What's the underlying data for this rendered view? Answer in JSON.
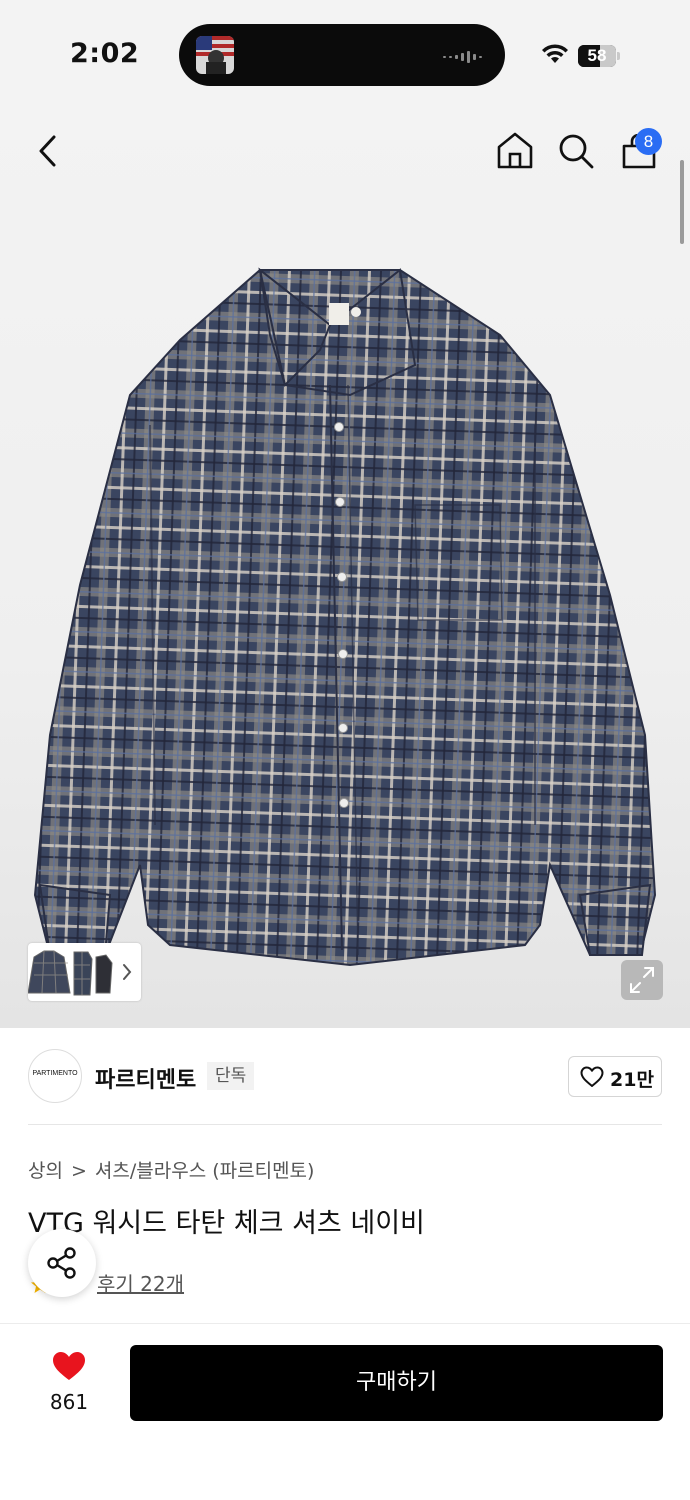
{
  "status_bar": {
    "time": "2:02",
    "battery_level": "58",
    "battery_fraction": 0.58
  },
  "header": {
    "cart_count": "8",
    "icons": [
      "back-arrow-icon",
      "home-icon",
      "search-icon",
      "shopping-bag-icon"
    ]
  },
  "gallery": {
    "thumbnail_count": 3,
    "expand_icon": "expand-icon"
  },
  "brand": {
    "logo_text": "PARTIMENTO",
    "name": "파르티멘토",
    "tag": "단독",
    "like_count": "21만"
  },
  "product": {
    "breadcrumb": [
      "상의",
      "셔츠/블라우스 (파르티멘토)"
    ],
    "breadcrumb_separator": ">",
    "title": "VTG 워시드 타탄 체크 셔츠 네이비",
    "review_link": "후기 22개"
  },
  "bottom_bar": {
    "wish_count": "861",
    "buy_label": "구매하기"
  },
  "colors": {
    "accent_blue": "#2a6df4",
    "heart_red": "#e8141e",
    "buy_button": "#000000"
  }
}
